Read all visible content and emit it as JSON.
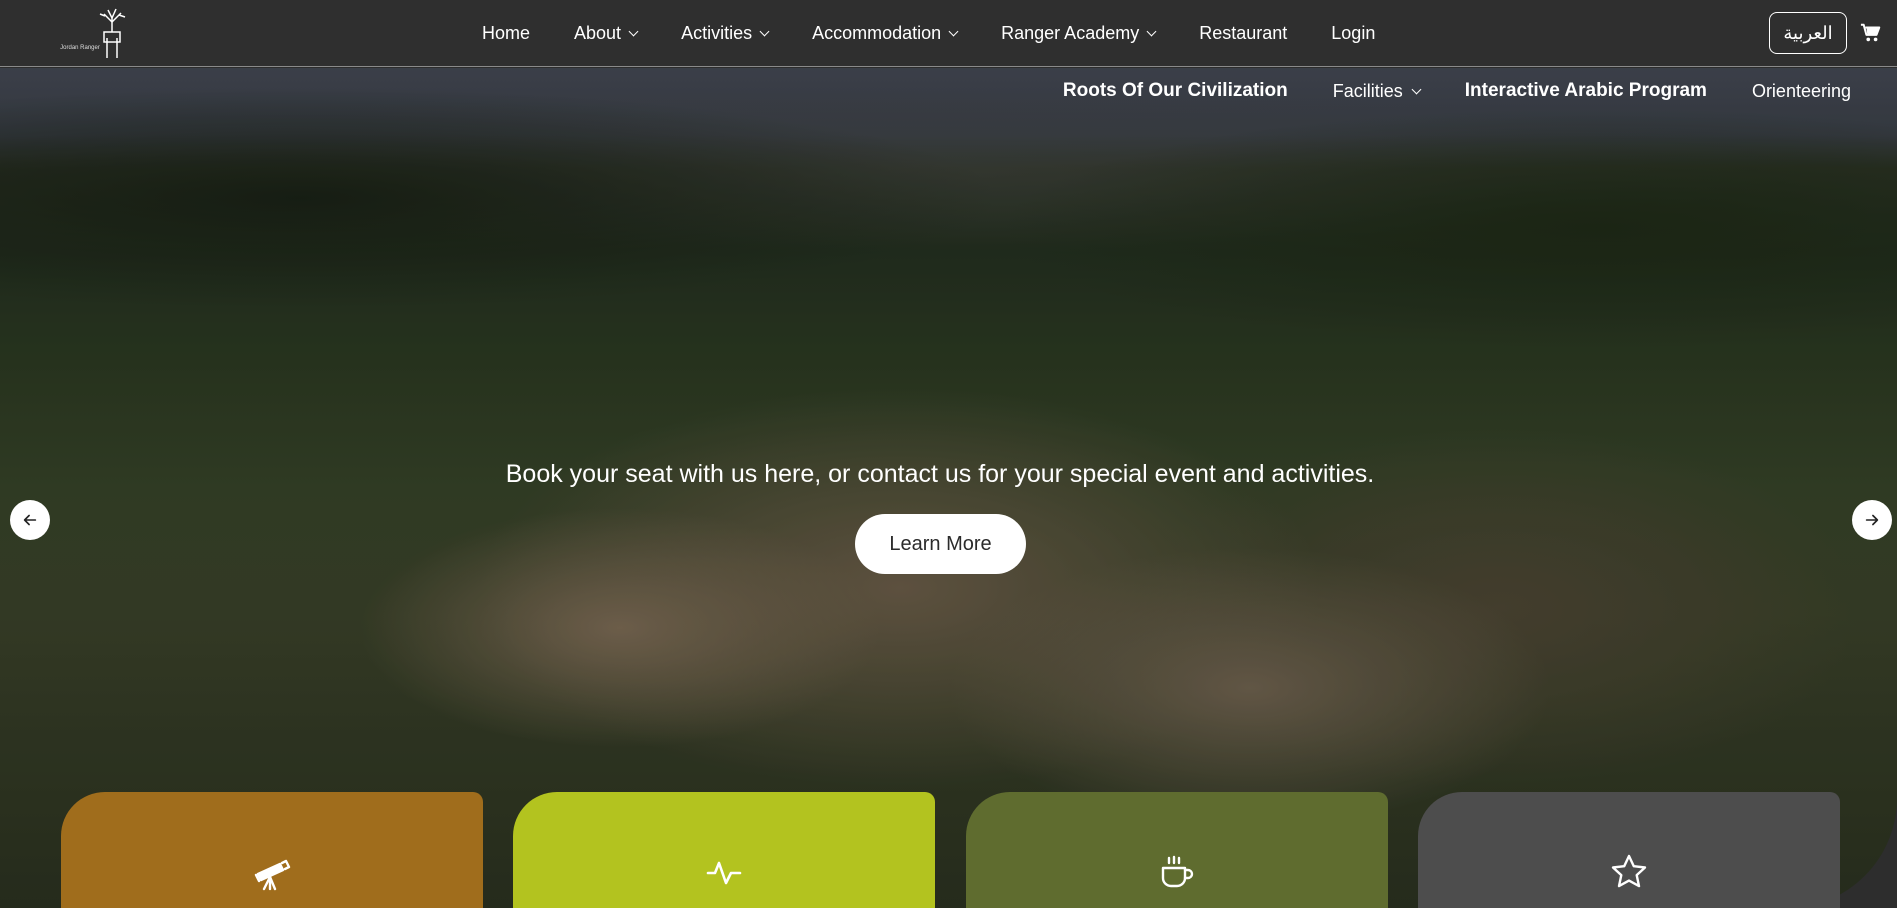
{
  "brand": {
    "logo_text": "Jordan Ranger"
  },
  "nav": {
    "items": [
      {
        "label": "Home",
        "dropdown": false
      },
      {
        "label": "About",
        "dropdown": true
      },
      {
        "label": "Activities",
        "dropdown": true
      },
      {
        "label": "Accommodation",
        "dropdown": true
      },
      {
        "label": "Ranger Academy",
        "dropdown": true
      },
      {
        "label": "Restaurant",
        "dropdown": false
      },
      {
        "label": "Login",
        "dropdown": false
      }
    ]
  },
  "language_button": "العربية",
  "cart_icon": "cart-icon",
  "sub_nav": {
    "items": [
      {
        "label": "Roots Of Our Civilization"
      },
      {
        "label": "Facilities"
      },
      {
        "label": "Interactive Arabic Program"
      },
      {
        "label": "Orienteering"
      }
    ]
  },
  "hero": {
    "tagline": "Book your seat with us here, or contact us for your special event and activities.",
    "cta_label": "Learn More"
  },
  "cards": [
    {
      "icon": "telescope-icon",
      "color": "#a06d1c"
    },
    {
      "icon": "activity-icon",
      "color": "#b3c31f"
    },
    {
      "icon": "coffee-icon",
      "color": "#5f6c2f"
    },
    {
      "icon": "star-icon",
      "color": "#4d4d4d"
    }
  ]
}
